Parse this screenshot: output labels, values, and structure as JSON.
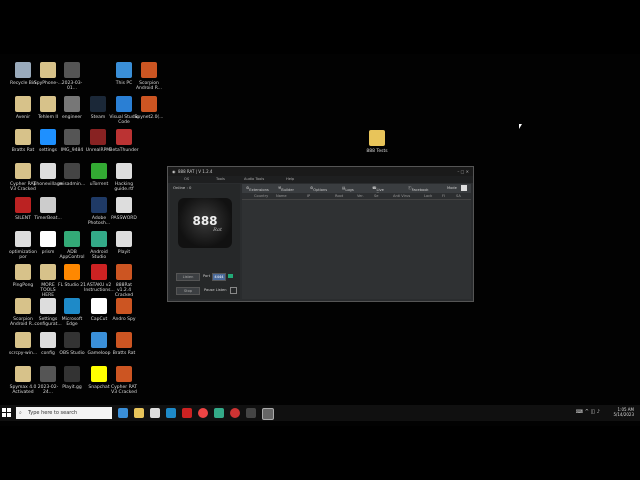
{
  "desktop_icons": [
    {
      "label": "Recycle Bin",
      "color": "#9ab"
    },
    {
      "label": "SpyPhone-...",
      "color": "#d7c28a"
    },
    {
      "label": "2023-03-01...",
      "color": "#555"
    },
    {
      "label": "This PC",
      "color": "#3a8fd8"
    },
    {
      "label": "Scorpion\nAndroid R...",
      "color": "#c52"
    },
    {
      "label": "Avenir",
      "color": "#d7c28a"
    },
    {
      "label": "Tehlem II",
      "color": "#d7c28a"
    },
    {
      "label": "engineer",
      "color": "#777"
    },
    {
      "label": "Steam",
      "color": "#1b2838"
    },
    {
      "label": "Visual Studio\nCode",
      "color": "#2a7fd4"
    },
    {
      "label": "Spynet2.0(...",
      "color": "#c52"
    },
    {
      "label": "Bratts Rat",
      "color": "#d7c28a"
    },
    {
      "label": "settings",
      "color": "#1e90ff"
    },
    {
      "label": "IMG_9484",
      "color": "#555"
    },
    {
      "label": "UnrealRPM",
      "color": "#822"
    },
    {
      "label": "BetaThunder",
      "color": "#b33"
    },
    {
      "label": "Cypher RAT\nV3 Cracked",
      "color": "#d7c28a"
    },
    {
      "label": "phonevillage",
      "color": "#ddd"
    },
    {
      "label": "misadmin...",
      "color": "#444"
    },
    {
      "label": "uTorrent",
      "color": "#3a3"
    },
    {
      "label": "Hacking\nguide.rtf",
      "color": "#ddd"
    },
    {
      "label": "SILENT",
      "color": "#b22"
    },
    {
      "label": "TimerBeat...",
      "color": "#ccc"
    },
    {
      "label": "Adobe\nPhotosh...",
      "color": "#1f3a66"
    },
    {
      "label": "PASSWORD",
      "color": "#ddd"
    },
    {
      "label": "optimization\npor",
      "color": "#ddd"
    },
    {
      "label": "prism",
      "color": "#fff"
    },
    {
      "label": "ADB\nAppControl",
      "color": "#3a7"
    },
    {
      "label": "Android\nStudio",
      "color": "#3a8"
    },
    {
      "label": "Playit",
      "color": "#ddd"
    },
    {
      "label": "PingPong",
      "color": "#d7c28a"
    },
    {
      "label": "MORE TOOLS\nHERE",
      "color": "#d7c28a"
    },
    {
      "label": "FL Studio 21",
      "color": "#f80"
    },
    {
      "label": "ASTAKU v2\nInstructions...",
      "color": "#c22"
    },
    {
      "label": "888Rat v1.2.4\nCracked",
      "color": "#c52"
    },
    {
      "label": "Scorpion\nAndroid R...",
      "color": "#d7c28a"
    },
    {
      "label": "Settings\nconfigurat...",
      "color": "#ddd"
    },
    {
      "label": "Microsoft\nEdge",
      "color": "#1e8ac8"
    },
    {
      "label": "CapCut",
      "color": "#fff"
    },
    {
      "label": "Andro Spy",
      "color": "#c52"
    },
    {
      "label": "scrcpy-win...",
      "color": "#d7c28a"
    },
    {
      "label": "config",
      "color": "#ddd"
    },
    {
      "label": "OBS Studio",
      "color": "#333"
    },
    {
      "label": "Gameloop",
      "color": "#3a8fd8"
    },
    {
      "label": "Bratts Rat",
      "color": "#c52"
    },
    {
      "label": "Spymax 4.0\nActivated",
      "color": "#d7c28a"
    },
    {
      "label": "2023-02-24...",
      "color": "#555"
    },
    {
      "label": "Playit.gg",
      "color": "#333"
    },
    {
      "label": "Snapchat",
      "color": "#ff0"
    },
    {
      "label": "Cypher RAT\nV3 Cracked",
      "color": "#c52"
    },
    {
      "label": "888 Tests",
      "color": "#e8c45a"
    }
  ],
  "window": {
    "title": "888 RAT | V 1.2.4",
    "menu": [
      "OS",
      "Tools",
      "Audio Tools",
      "Help"
    ],
    "online_label": "Online : 0",
    "logo_text": "888",
    "logo_sub": "Rat",
    "listen_label": "Listen",
    "port_label": "Port",
    "port_value": "4444",
    "stop_label": "Stop",
    "pause_label": "Pause Listen",
    "toolbar": [
      "Extensions",
      "Builder",
      "Options",
      "Logs",
      "Live Num",
      "Facebook"
    ],
    "mode_label": "Mode",
    "columns": [
      "Country",
      "Name",
      "IP",
      "Root",
      "Ver.",
      "Se",
      "Anti Virus",
      "Lock",
      "FI",
      "SA"
    ]
  },
  "taskbar": {
    "search_placeholder": "Type here to search",
    "time": "1:05 AM",
    "date": "5/14/2023"
  }
}
